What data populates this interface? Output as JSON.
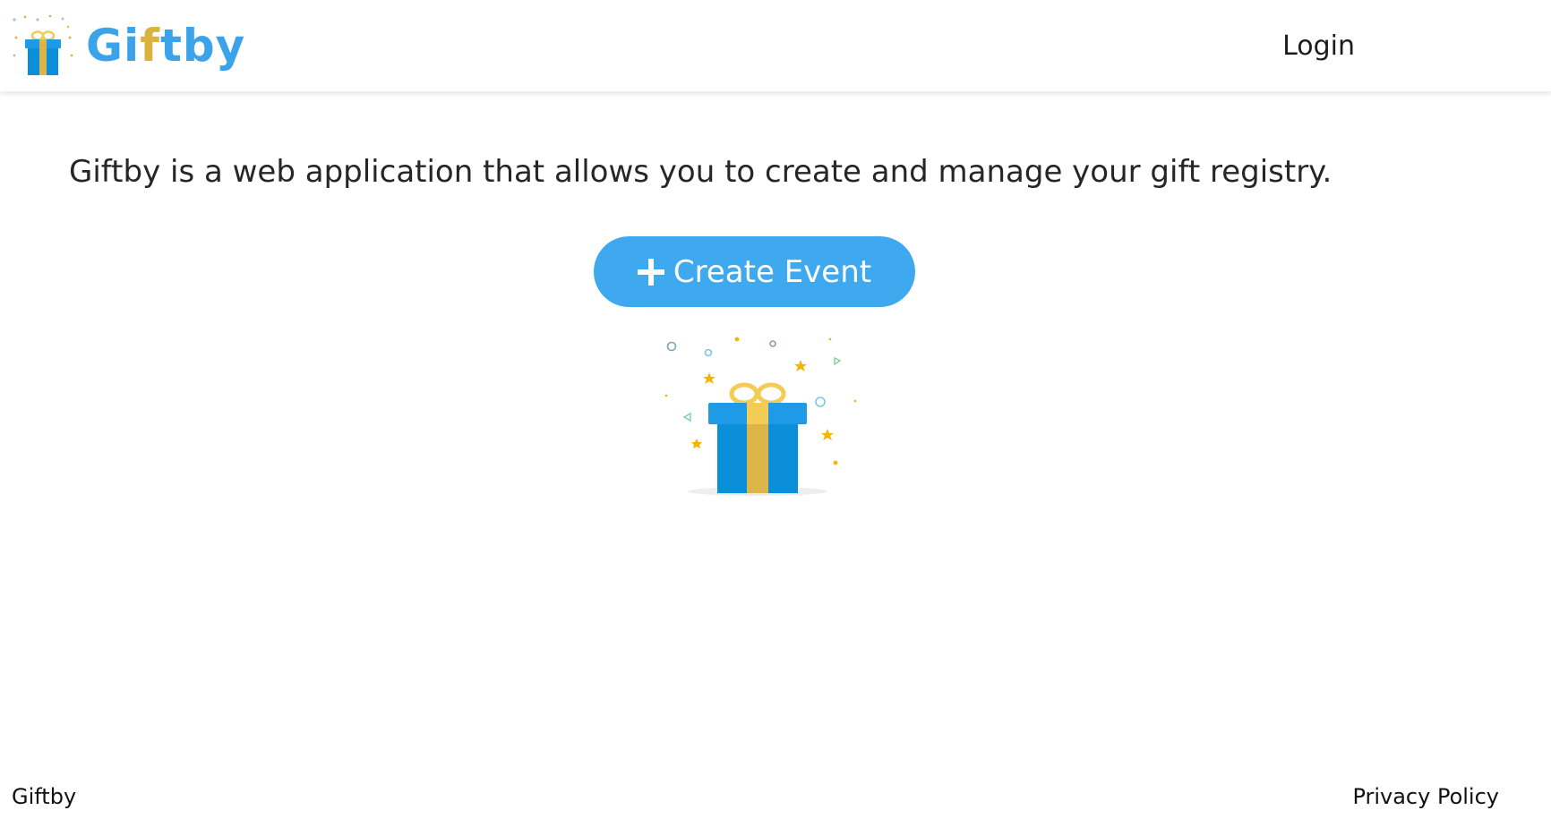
{
  "header": {
    "logo": {
      "text_part1": "Gi",
      "text_part2": "f",
      "text_part3": "tby",
      "brand_blue": "#3aa3ea",
      "brand_gold": "#d9b33e",
      "icon": "gift-box-icon"
    },
    "login_label": "Login"
  },
  "main": {
    "tagline": "Giftby is a web application that allows you to create and manage your gift registry.",
    "create_button": {
      "label": "Create Event",
      "icon": "plus-icon",
      "color": "#3fa9f0"
    },
    "illustration": {
      "icon": "gift-box-with-confetti-icon",
      "box_color": "#0a8fd8",
      "ribbon_color": "#ddb447"
    }
  },
  "footer": {
    "brand_label": "Giftby",
    "privacy_label": "Privacy Policy"
  }
}
